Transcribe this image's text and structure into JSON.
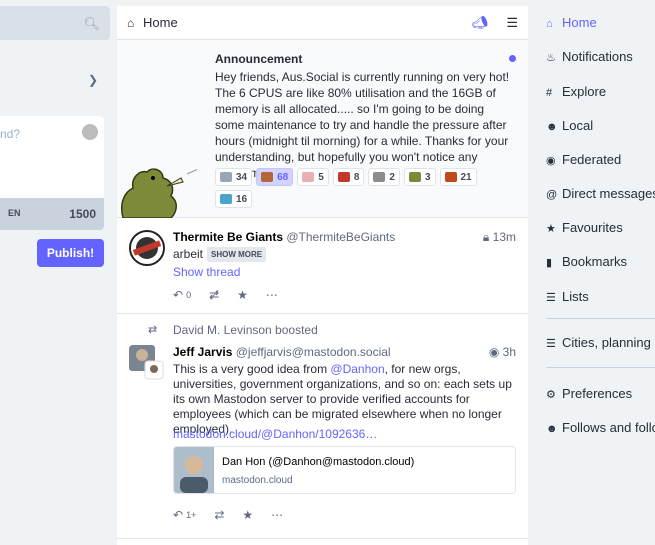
{
  "compose": {
    "placeholder": "nd?",
    "language": "EN",
    "char_count": "1500",
    "publish_label": "Publish!"
  },
  "header": {
    "title": "Home",
    "icons": [
      "home-icon",
      "megaphone-icon",
      "sliders-icon"
    ]
  },
  "announcement": {
    "title": "Announcement",
    "body": "Hey friends, Aus.Social is currently running on very hot! The 6 CPUS are like 80% utilisation and the 16GB of memory is all allocated..... so I'm going to be doing some maintenance to try and handle the pressure after hours (midnight til morning) for a while. Thanks for your understanding, but hopefully you won't notice any downtime.",
    "reactions": [
      {
        "count": "34",
        "color": "#9aa6b5",
        "active": false
      },
      {
        "count": "68",
        "color": "#b5653a",
        "active": true
      },
      {
        "count": "5",
        "color": "#e8b0b0",
        "active": false
      },
      {
        "count": "8",
        "color": "#c0392b",
        "active": false
      },
      {
        "count": "2",
        "color": "#8c8c8c",
        "active": false
      },
      {
        "count": "3",
        "color": "#7c8a3a",
        "active": false
      },
      {
        "count": "21",
        "color": "#c04a1a",
        "active": false
      },
      {
        "count": "16",
        "color": "#4aa3c9",
        "active": false
      }
    ]
  },
  "statuses": [
    {
      "display_name": "Thermite Be Giants",
      "acct": "@ThermiteBeGiants",
      "time": "13m",
      "text": "arbeit",
      "show_more": "SHOW MORE",
      "show_thread": "Show thread",
      "reply_count": "0"
    },
    {
      "boosted_by": "David M. Levinson boosted",
      "display_name": "Jeff Jarvis",
      "acct": "@jeffjarvis@mastodon.social",
      "time": "3h",
      "text_before": "This is a very good idea from ",
      "mention": "@Danhon",
      "text_after": ", for new orgs, universities, government organizations, and so on: each sets up its own Mastodon server to provide verified accounts for employees (which can be migrated elsewhere  when no longer employed).",
      "link": "mastodon.cloud/@Danhon/1092636…",
      "card_title": "Dan Hon (@Danhon@mastodon.cloud)",
      "card_site": "mastodon.cloud",
      "reply_count": "1+"
    }
  ],
  "nav": [
    {
      "label": "Home",
      "icon": "home-icon",
      "active": true
    },
    {
      "label": "Notifications",
      "icon": "bell-icon"
    },
    {
      "label": "Explore",
      "icon": "hashtag-icon"
    },
    {
      "label": "Local",
      "icon": "users-icon"
    },
    {
      "label": "Federated",
      "icon": "globe-icon"
    },
    {
      "label": "Direct messages",
      "icon": "at-icon"
    },
    {
      "label": "Favourites",
      "icon": "star-icon"
    },
    {
      "label": "Bookmarks",
      "icon": "bookmark-icon"
    },
    {
      "label": "Lists",
      "icon": "list-icon"
    },
    {
      "label": "Cities, planning an",
      "icon": "list-icon"
    },
    {
      "label": "Preferences",
      "icon": "gear-icon"
    },
    {
      "label": "Follows and follow",
      "icon": "users-icon"
    }
  ],
  "colors": {
    "accent": "#6364ff",
    "background": "#eff3f5"
  }
}
